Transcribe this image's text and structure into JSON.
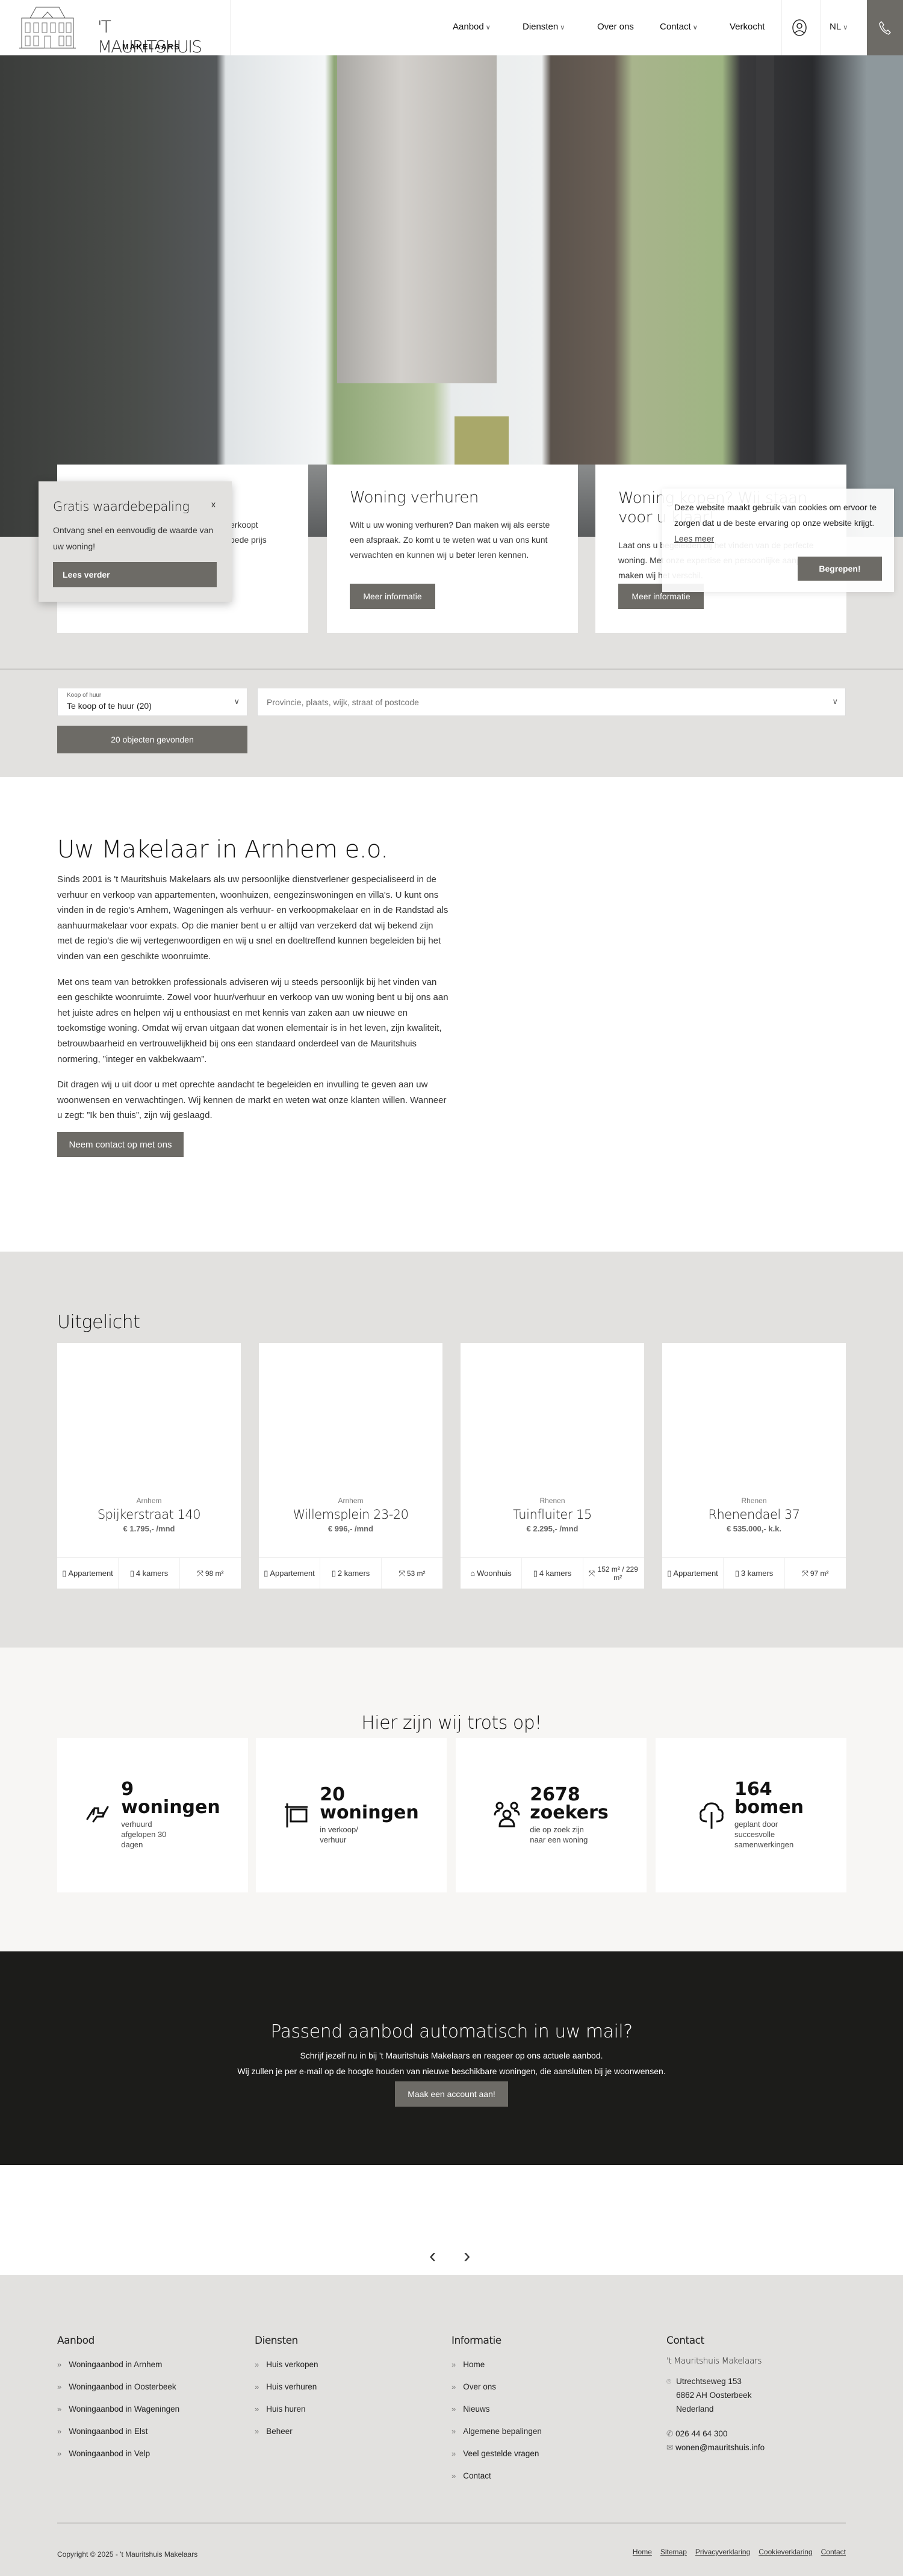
{
  "header": {
    "logo_name": "'t Mauritshuis",
    "logo_sub": "MAKELAARS",
    "nav": [
      {
        "label": "Aanbod",
        "dropdown": true
      },
      {
        "label": "Diensten",
        "dropdown": true
      },
      {
        "label": "Over ons",
        "dropdown": false
      },
      {
        "label": "Contact",
        "dropdown": true
      },
      {
        "label": "Verkocht",
        "dropdown": false
      }
    ],
    "language": "NL",
    "user_icon": "user-circle-icon",
    "phone_icon": "phone-icon"
  },
  "hero_cards": [
    {
      "title": "",
      "lines": [
        "erkoopt",
        "oede prijs"
      ],
      "button": ""
    },
    {
      "title": "Woning verhuren",
      "text": "Wilt u uw woning verhuren? Dan maken wij als eerste een afspraak. Zo komt u te weten wat u van ons kunt verwachten en kunnen wij u beter leren kennen.",
      "button": "Meer informatie"
    },
    {
      "title": "Woning kopen? Wij staan voor u klaar!",
      "text": "Laat ons u begeleiden bij het vinden van de perfecte woning. Met onze expertise en persoonlijke aanpak maken wij het verschil.",
      "button": "Meer informatie"
    }
  ],
  "popup": {
    "title": "Gratis waardebepaling",
    "close": "x",
    "text": "Ontvang snel en eenvoudig de waarde van uw woning!",
    "button": "Lees verder"
  },
  "cookie": {
    "text": "Deze website maakt gebruik van cookies om ervoor te zorgen dat u de beste ervaring op onze website krijgt.",
    "link": "Lees meer",
    "button": "Begrepen!"
  },
  "search": {
    "select_label": "Koop of huur",
    "select_value": "Te koop of te huur (20)",
    "location_placeholder": "Provincie, plaats, wijk, straat of postcode",
    "result_button": "20 objecten gevonden"
  },
  "intro": {
    "title": "Uw Makelaar in Arnhem e.o.",
    "paragraphs": [
      "Sinds 2001 is 't Mauritshuis Makelaars als uw persoonlijke dienstverlener gespecialiseerd in de verhuur en verkoop van appartementen, woonhuizen, eengezinswoningen en villa's. U kunt ons vinden in de regio's Arnhem, Wageningen als verhuur- en verkoopmakelaar en in de Randstad als aanhuurmakelaar voor expats. Op die manier bent u er altijd van verzekerd dat wij bekend zijn met de regio's die wij vertegenwoordigen en wij u snel en doeltreffend kunnen begeleiden bij het vinden van een geschikte woonruimte.",
      "Met ons team van betrokken professionals adviseren wij u steeds persoonlijk bij het vinden van een geschikte woonruimte. Zowel voor huur/verhuur en verkoop van uw woning bent u bij ons aan het juiste adres en helpen wij u enthousiast en met kennis van zaken aan uw nieuwe en toekomstige woning. Omdat wij ervan uitgaan dat wonen elementair is in het leven, zijn kwaliteit, betrouwbaarheid en vertrouwelijkheid bij ons een standaard onderdeel van de Mauritshuis normering, ”integer en vakbekwaam”.",
      "Dit dragen wij u uit door u met oprechte aandacht te begeleiden en invulling te geven aan uw woonwensen en verwachtingen. Wij kennen de markt en weten wat onze klanten willen. Wanneer u zegt: ”Ik ben thuis”, zijn wij geslaagd."
    ],
    "button": "Neem contact op met ons"
  },
  "featured": {
    "title": "Uitgelicht",
    "items": [
      {
        "city": "Arnhem",
        "street": "Spijkerstraat 140",
        "price": "€ 1.795,- /mnd",
        "type": "Appartement",
        "rooms": "4 kamers",
        "area": "98 m²"
      },
      {
        "city": "Arnhem",
        "street": "Willemsplein 23-20",
        "price": "€ 996,- /mnd",
        "type": "Appartement",
        "rooms": "2 kamers",
        "area": "53 m²"
      },
      {
        "city": "Rhenen",
        "street": "Tuinfluiter 15",
        "price": "€ 2.295,- /mnd",
        "type": "Woonhuis",
        "rooms": "4 kamers",
        "area": "152 m² / 229 m²"
      },
      {
        "city": "Rhenen",
        "street": "Rhenendael 37",
        "price": "€ 535.000,- k.k.",
        "type": "Appartement",
        "rooms": "3 kamers",
        "area": "97 m²"
      }
    ]
  },
  "stats": {
    "title": "Hier zijn wij trots op!",
    "items": [
      {
        "icon": "handshake-icon",
        "number": "9",
        "unit": "woningen",
        "sub": "verhuurd afgelopen 30 dagen"
      },
      {
        "icon": "sign-icon",
        "number": "20",
        "unit": "woningen",
        "sub": "in verkoop/ verhuur"
      },
      {
        "icon": "people-icon",
        "number": "2678",
        "unit": "zoekers",
        "sub": "die op zoek zijn naar een woning"
      },
      {
        "icon": "tree-icon",
        "number": "164",
        "unit": "bomen",
        "sub": "geplant door succesvolle samenwerkingen"
      }
    ]
  },
  "cta": {
    "title": "Passend aanbod automatisch in uw mail?",
    "line1": "Schrijf jezelf nu in bij 't Mauritshuis Makelaars en reageer op ons actuele aanbod.",
    "line2": "Wij zullen je per e-mail op de hoogte houden van nieuwe beschikbare woningen, die aansluiten bij je woonwensen.",
    "button": "Maak een account aan!"
  },
  "carousel": {
    "prev": "‹",
    "next": "›"
  },
  "footer": {
    "aanbod": {
      "title": "Aanbod",
      "items": [
        "Woningaanbod in Arnhem",
        "Woningaanbod in Oosterbeek",
        "Woningaanbod in Wageningen",
        "Woningaanbod in Elst",
        "Woningaanbod in Velp"
      ]
    },
    "diensten": {
      "title": "Diensten",
      "items": [
        "Huis verkopen",
        "Huis verhuren",
        "Huis huren",
        "Beheer"
      ]
    },
    "informatie": {
      "title": "Informatie",
      "items": [
        "Home",
        "Over ons",
        "Nieuws",
        "Algemene bepalingen",
        "Veel gestelde vragen",
        "Contact"
      ]
    },
    "contact": {
      "title": "Contact",
      "company": "'t Mauritshuis Makelaars",
      "street": "Utrechtseweg 153",
      "city": "6862 AH Oosterbeek",
      "country": "Nederland",
      "phone": "026 44 64 300",
      "email": "wonen@mauritshuis.info"
    },
    "copyright": "Copyright © 2025 - 't Mauritshuis Makelaars",
    "links": [
      "Home",
      "Sitemap",
      "Privacyverklaring",
      "Cookieverklaring",
      "Contact"
    ]
  },
  "colors": {
    "button": "#6d6b66",
    "section_gray": "#e2e1df",
    "stats_bg": "#f7f6f4",
    "dark": "#1c1c1a"
  }
}
